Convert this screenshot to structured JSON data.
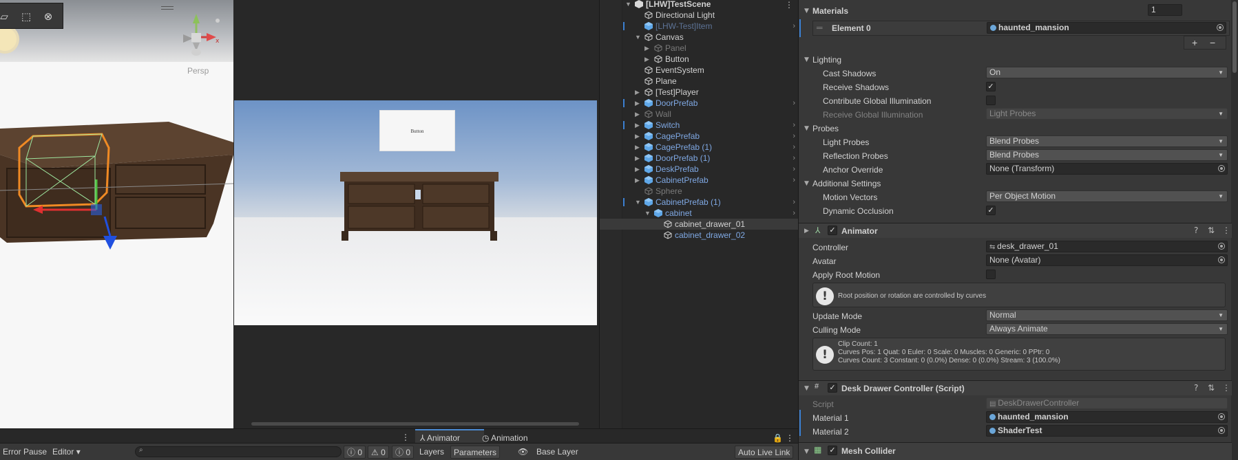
{
  "scene": {
    "persp_label": "Persp",
    "tools": [
      "rect-tool-icon",
      "transform-tool-icon",
      "custom-tool-icon"
    ]
  },
  "game": {
    "button_text": "Button"
  },
  "hierarchy": {
    "rows": [
      {
        "label": "[LHW]TestScene",
        "indent": 0,
        "arrow": "▼",
        "color": "plain",
        "icon": "scene",
        "bold": true,
        "mark": false,
        "expand": false
      },
      {
        "label": "Directional Light",
        "indent": 1,
        "arrow": "",
        "color": "plain",
        "icon": "cube",
        "mark": false,
        "expand": false
      },
      {
        "label": "[LHW-Test]Item",
        "indent": 1,
        "arrow": "",
        "color": "disabled-prefab",
        "icon": "prefab",
        "mark": true,
        "expand": true
      },
      {
        "label": "Canvas",
        "indent": 1,
        "arrow": "▼",
        "color": "plain",
        "icon": "cube",
        "mark": false,
        "expand": false
      },
      {
        "label": "Panel",
        "indent": 2,
        "arrow": "▶",
        "color": "disabled",
        "icon": "cube",
        "mark": false,
        "expand": false
      },
      {
        "label": "Button",
        "indent": 2,
        "arrow": "▶",
        "color": "plain",
        "icon": "cube",
        "mark": false,
        "expand": false
      },
      {
        "label": "EventSystem",
        "indent": 1,
        "arrow": "",
        "color": "plain",
        "icon": "cube",
        "mark": false,
        "expand": false
      },
      {
        "label": "Plane",
        "indent": 1,
        "arrow": "",
        "color": "plain",
        "icon": "cube",
        "mark": false,
        "expand": false
      },
      {
        "label": "[Test]Player",
        "indent": 1,
        "arrow": "▶",
        "color": "plain",
        "icon": "cube",
        "mark": false,
        "expand": false
      },
      {
        "label": "DoorPrefab",
        "indent": 1,
        "arrow": "▶",
        "color": "prefab",
        "icon": "prefab",
        "mark": true,
        "expand": true
      },
      {
        "label": "Wall",
        "indent": 1,
        "arrow": "▶",
        "color": "disabled",
        "icon": "cube",
        "mark": false,
        "expand": false
      },
      {
        "label": "Switch",
        "indent": 1,
        "arrow": "▶",
        "color": "prefab",
        "icon": "prefab",
        "mark": true,
        "expand": true
      },
      {
        "label": "CagePrefab",
        "indent": 1,
        "arrow": "▶",
        "color": "prefab",
        "icon": "prefab",
        "mark": false,
        "expand": true
      },
      {
        "label": "CagePrefab (1)",
        "indent": 1,
        "arrow": "▶",
        "color": "prefab",
        "icon": "prefab",
        "mark": false,
        "expand": true
      },
      {
        "label": "DoorPrefab (1)",
        "indent": 1,
        "arrow": "▶",
        "color": "prefab",
        "icon": "prefab",
        "mark": false,
        "expand": true
      },
      {
        "label": "DeskPrefab",
        "indent": 1,
        "arrow": "▶",
        "color": "prefab",
        "icon": "prefab",
        "mark": false,
        "expand": true
      },
      {
        "label": "CabinetPrefab",
        "indent": 1,
        "arrow": "▶",
        "color": "prefab",
        "icon": "prefab",
        "mark": false,
        "expand": true
      },
      {
        "label": "Sphere",
        "indent": 1,
        "arrow": "",
        "color": "disabled",
        "icon": "cube",
        "mark": false,
        "expand": false
      },
      {
        "label": "CabinetPrefab (1)",
        "indent": 1,
        "arrow": "▼",
        "color": "prefab",
        "icon": "prefab",
        "mark": true,
        "expand": true
      },
      {
        "label": "cabinet",
        "indent": 2,
        "arrow": "▼",
        "color": "prefab",
        "icon": "prefab",
        "mark": false,
        "expand": true
      },
      {
        "label": "cabinet_drawer_01",
        "indent": 3,
        "arrow": "",
        "color": "plain",
        "icon": "cube",
        "mark": false,
        "expand": false,
        "selected": true
      },
      {
        "label": "cabinet_drawer_02",
        "indent": 3,
        "arrow": "",
        "color": "prefab",
        "icon": "cube",
        "mark": false,
        "expand": false
      }
    ]
  },
  "inspector": {
    "materials": {
      "title": "Materials",
      "count": "1",
      "element_label": "Element 0",
      "element_value": "haunted_mansion",
      "add": "+",
      "remove": "−"
    },
    "lighting": {
      "title": "Lighting",
      "cast_shadows_label": "Cast Shadows",
      "cast_shadows_value": "On",
      "receive_shadows_label": "Receive Shadows",
      "contribute_gi_label": "Contribute Global Illumination",
      "receive_gi_label": "Receive Global Illumination",
      "receive_gi_value": "Light Probes"
    },
    "probes": {
      "title": "Probes",
      "light_probes_label": "Light Probes",
      "light_probes_value": "Blend Probes",
      "reflection_probes_label": "Reflection Probes",
      "reflection_probes_value": "Blend Probes",
      "anchor_label": "Anchor Override",
      "anchor_value": "None (Transform)"
    },
    "additional": {
      "title": "Additional Settings",
      "motion_vectors_label": "Motion Vectors",
      "motion_vectors_value": "Per Object Motion",
      "dynamic_occlusion_label": "Dynamic Occlusion"
    },
    "animator": {
      "title": "Animator",
      "controller_label": "Controller",
      "controller_value": "desk_drawer_01",
      "avatar_label": "Avatar",
      "avatar_value": "None (Avatar)",
      "root_motion_label": "Apply Root Motion",
      "root_motion_help": "Root position or rotation are controlled by curves",
      "update_mode_label": "Update Mode",
      "update_mode_value": "Normal",
      "culling_mode_label": "Culling Mode",
      "culling_mode_value": "Always Animate",
      "clip_info": [
        "Clip Count: 1",
        "Curves Pos: 1 Quat: 0 Euler: 0 Scale: 0 Muscles: 0 Generic: 0 PPtr: 0",
        "Curves Count: 3 Constant: 0 (0.0%) Dense: 0 (0.0%) Stream: 3 (100.0%)"
      ]
    },
    "script_component": {
      "title": "Desk Drawer Controller (Script)",
      "script_label": "Script",
      "script_value": "DeskDrawerController",
      "material1_label": "Material 1",
      "material1_value": "haunted_mansion",
      "material2_label": "Material 2",
      "material2_value": "ShaderTest"
    },
    "mesh_collider": {
      "title": "Mesh Collider"
    }
  },
  "bottom": {
    "animator_tab": "Animator",
    "animation_tab": "Animation",
    "error_pause": "Error Pause",
    "editor": "Editor",
    "counts": {
      "info": "0",
      "warn": "0",
      "error": "0"
    },
    "layers_tab": "Layers",
    "parameters_tab": "Parameters",
    "base_layer": "Base Layer",
    "auto_live_link": "Auto Live Link"
  },
  "colors": {
    "prefab": "#7fa8e3",
    "selection_mark": "#3b7fd1",
    "panel_bg": "#383838"
  }
}
